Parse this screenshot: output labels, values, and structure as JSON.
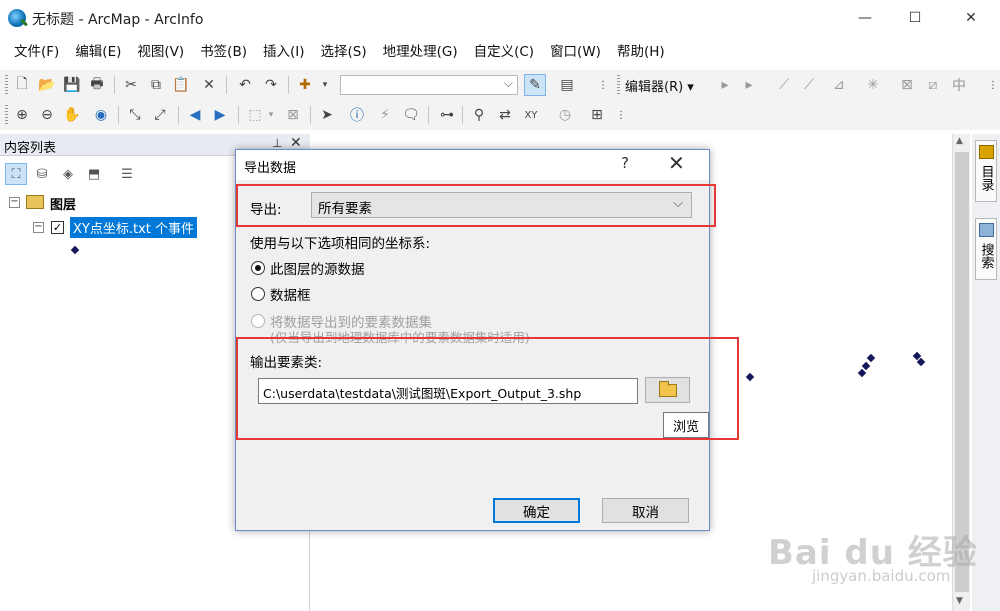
{
  "window": {
    "title": "无标题 - ArcMap - ArcInfo",
    "minimize": "—",
    "maximize": "☐",
    "close": "✕"
  },
  "menu": [
    "文件(F)",
    "编辑(E)",
    "视图(V)",
    "书签(B)",
    "插入(I)",
    "选择(S)",
    "地理处理(G)",
    "自定义(C)",
    "窗口(W)",
    "帮助(H)"
  ],
  "toolbar": {
    "editor_label": "编辑器(R) ▾",
    "scale_value": ""
  },
  "toc": {
    "title": "内容列表",
    "pin": "📌",
    "close": "✕",
    "root_label": "图层",
    "layer_label": "XY点坐标.txt 个事件",
    "expand_root": "−",
    "expand_layer": "−",
    "checked": "✓"
  },
  "side_tabs": {
    "catalog": "目录",
    "search": "搜索"
  },
  "dialog": {
    "title": "导出数据",
    "help": "?",
    "close": "✕",
    "export_label": "导出:",
    "export_value": "所有要素",
    "coord_label": "使用与以下选项相同的坐标系:",
    "radio_source": "此图层的源数据",
    "radio_frame": "数据框",
    "radio_dataset": "将数据导出到的要素数据集",
    "radio_dataset_note": "(仅当导出到地理数据库中的要素数据集时适用)",
    "output_label": "输出要素类:",
    "output_path": "C:\\userdata\\testdata\\测试图斑\\Export_Output_3.shp",
    "tooltip": "浏览",
    "ok": "确定",
    "cancel": "取消"
  },
  "watermark": {
    "brand": "Bai du 经验",
    "url": "jingyan.baidu.com"
  }
}
